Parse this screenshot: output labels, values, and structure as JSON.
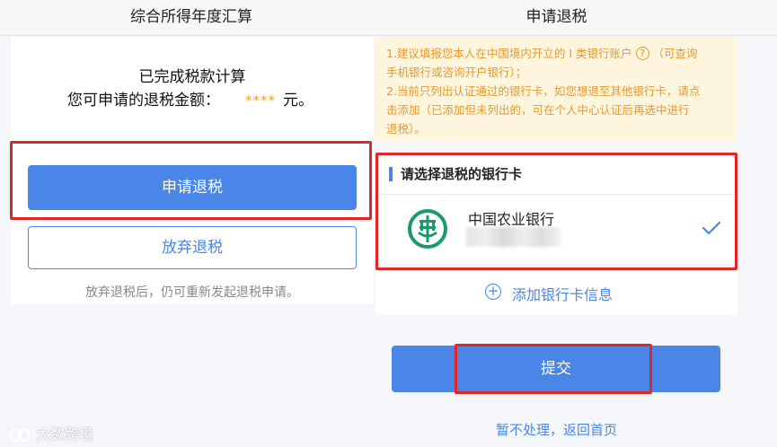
{
  "left_panel": {
    "title": "综合所得年度汇算",
    "status_text": "已完成税款计算",
    "refund_label": "您可申请的退税金额：",
    "refund_amount": "****",
    "refund_unit": "元。",
    "apply_button_label": "申请退税",
    "give_up_button_label": "放弃退税",
    "give_up_note": "放弃退税后，仍可重新发起退税申请。"
  },
  "right_panel": {
    "title": "申请退税",
    "notice": {
      "line1_a": "1.建议填报您本人在中国境内开立的 I 类银行账户",
      "line1_icon": "?",
      "line1_b": "（可查询",
      "line2": "手机银行或咨询开户银行）；",
      "line3": "2.当前只列出认证通过的银行卡，如您想退至其他银行卡，请点",
      "line4": "击添加（已添加但未列出的，可在个人中心认证后再选中进行",
      "line5": "退税）。"
    },
    "section_title": "请选择退税的银行卡",
    "bank": {
      "name": "中国农业银行",
      "logo_icon": "abc-bank-logo-icon",
      "selected_icon": "check-icon"
    },
    "add_card_label": "添加银行卡信息",
    "add_icon_glyph": "+",
    "submit_button_label": "提交",
    "back_link_label": "暂不处理，返回首页"
  },
  "watermark": {
    "text": "大数跨境"
  },
  "colors": {
    "accent": "#4a86e8",
    "highlight_box": "#e02727",
    "notice_bg": "#fdf5de",
    "notice_text": "#e69a2e",
    "bank_green": "#1a9a6a"
  }
}
